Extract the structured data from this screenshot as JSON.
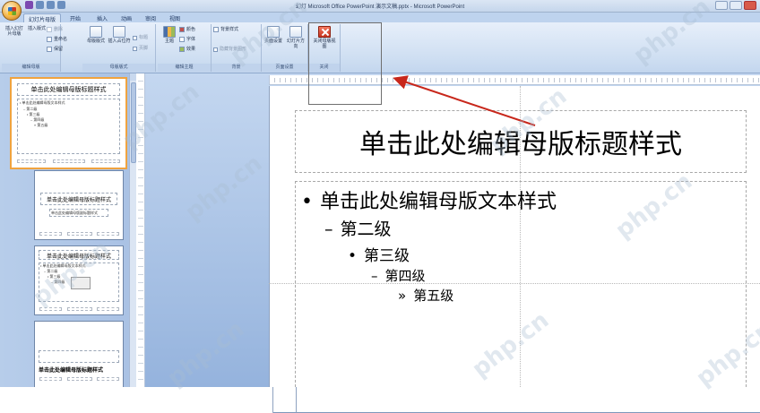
{
  "window": {
    "title": "幻灯 Microsoft Office PowerPoint 演示文稿.pptx - Microsoft PowerPoint"
  },
  "tabs": [
    {
      "label": "幻灯片母版",
      "active": true
    },
    {
      "label": "开始",
      "active": false
    },
    {
      "label": "插入",
      "active": false
    },
    {
      "label": "动画",
      "active": false
    },
    {
      "label": "审阅",
      "active": false
    },
    {
      "label": "视图",
      "active": false
    }
  ],
  "ribbon": {
    "groups": [
      {
        "label": "编辑母版"
      },
      {
        "label": "母版版式"
      },
      {
        "label": "编辑主题"
      },
      {
        "label": "背景"
      },
      {
        "label": "页面设置"
      },
      {
        "label": "关闭"
      }
    ],
    "buttons": {
      "insert_master": "插入幻灯片母版",
      "insert_layout": "插入版式",
      "delete": "删除",
      "rename": "重命名",
      "preserve": "保留",
      "master_layout": "母版版式",
      "insert_placeholder": "插入占位符",
      "title_check": "标题",
      "footer_check": "页脚",
      "theme": "主题",
      "colors": "颜色",
      "fonts": "字体",
      "effects": "效果",
      "bg_styles": "背景样式",
      "hide_bg": "隐藏背景图形",
      "page_setup": "页面设置",
      "orientation": "幻灯片方向",
      "close_view": "关闭母版视图"
    }
  },
  "slide": {
    "title": "单击此处编辑母版标题样式",
    "levels": [
      {
        "marker": "•",
        "text": "单击此处编辑母版文本样式"
      },
      {
        "marker": "–",
        "text": "第二级"
      },
      {
        "marker": "•",
        "text": "第三级"
      },
      {
        "marker": "–",
        "text": "第四级"
      },
      {
        "marker": "»",
        "text": "第五级"
      }
    ]
  },
  "thumbnails": {
    "master_title": "单击此处编辑母版标题样式",
    "master_body": "• 单击此处编辑母版文本样式",
    "master_l2": "– 第二级",
    "master_l3": "• 第三级",
    "master_l4": "– 第四级",
    "master_l5": "» 第五级",
    "layout1_title": "单击此处编辑母版标题样式",
    "layout1_sub": "单击此处编辑母版副标题样式",
    "layout2_title": "单击此处编辑母版标题样式",
    "layout2_body": "• 单击此处编辑母版文本样式",
    "layout2_l2": "– 第二级",
    "layout2_l3": "• 第三级",
    "layout2_l4": "– 第四级",
    "layout3_title": "单击此处编辑母版标题样式"
  },
  "watermark": "php.cn"
}
